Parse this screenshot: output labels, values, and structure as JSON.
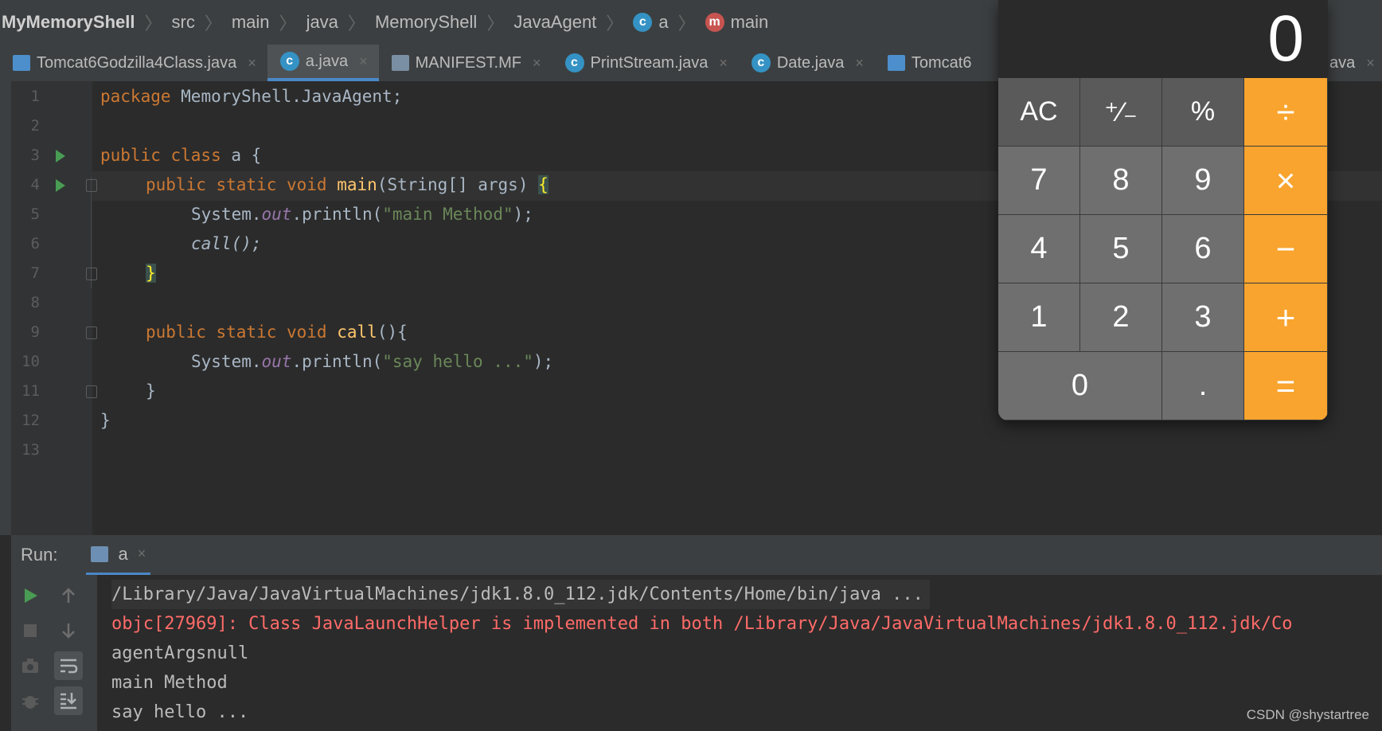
{
  "breadcrumb": {
    "items": [
      "MyMemoryShell",
      "src",
      "main",
      "java",
      "MemoryShell",
      "JavaAgent",
      "a",
      "main"
    ],
    "class_icon": "class-icon",
    "method_icon_letter": "m"
  },
  "tabs": [
    {
      "label": "Tomcat6Godzilla4Class.java",
      "icon": "jar-file-icon",
      "active": false
    },
    {
      "label": "a.java",
      "icon": "java-class-icon",
      "active": true
    },
    {
      "label": "MANIFEST.MF",
      "icon": "manifest-file-icon",
      "active": false
    },
    {
      "label": "PrintStream.java",
      "icon": "java-class-icon",
      "active": false
    },
    {
      "label": "Date.java",
      "icon": "java-class-icon",
      "active": false
    },
    {
      "label": "Tomcat6",
      "icon": "jar-file-icon",
      "active": false
    },
    {
      "label": "ava",
      "icon": "",
      "active": false
    }
  ],
  "tab_close_glyph": "×",
  "editor": {
    "line_numbers": [
      "1",
      "2",
      "3",
      "4",
      "5",
      "6",
      "7",
      "8",
      "9",
      "10",
      "11",
      "12",
      "13"
    ],
    "code": {
      "l1_kw": "package",
      "l1_rest": " MemoryShell.JavaAgent;",
      "l3_kw": "public class",
      "l3_rest": " a {",
      "l4_kw": "public static void",
      "l4_fn": "main",
      "l4_rest": "(String[] args) ",
      "l4_brace": "{",
      "l5_a": "System.",
      "l5_field": "out",
      "l5_b": ".println(",
      "l5_str": "\"main Method\"",
      "l5_c": ");",
      "l6": "call();",
      "l7_brace": "}",
      "l9_kw": "public static void",
      "l9_fn": "call",
      "l9_rest": "(){",
      "l10_a": "System.",
      "l10_field": "out",
      "l10_b": ".println(",
      "l10_str": "\"say hello ...\"",
      "l10_c": ");",
      "l11": "}",
      "l12": "}"
    }
  },
  "run_panel": {
    "label": "Run:",
    "tab_label": "a",
    "console_lines": [
      {
        "text": "/Library/Java/JavaVirtualMachines/jdk1.8.0_112.jdk/Contents/Home/bin/java ...",
        "kind": "cmd"
      },
      {
        "text": "objc[27969]: Class JavaLaunchHelper is implemented in both /Library/Java/JavaVirtualMachines/jdk1.8.0_112.jdk/Co",
        "kind": "err"
      },
      {
        "text": "agentArgsnull",
        "kind": "out"
      },
      {
        "text": "main Method",
        "kind": "out"
      },
      {
        "text": "say hello ...",
        "kind": "out"
      }
    ]
  },
  "calculator": {
    "display": "0",
    "keys": {
      "ac": "AC",
      "plusminus": "⁺∕₋",
      "percent": "%",
      "divide": "÷",
      "seven": "7",
      "eight": "8",
      "nine": "9",
      "multiply": "×",
      "four": "4",
      "five": "5",
      "six": "6",
      "minus": "−",
      "one": "1",
      "two": "2",
      "three": "3",
      "plus": "+",
      "zero": "0",
      "dot": ".",
      "equals": "="
    },
    "colors": {
      "operator": "#f8a42e",
      "function_key": "#5a5a5a",
      "number_key": "#6f6f6f"
    }
  },
  "watermark": "CSDN @shystartree"
}
